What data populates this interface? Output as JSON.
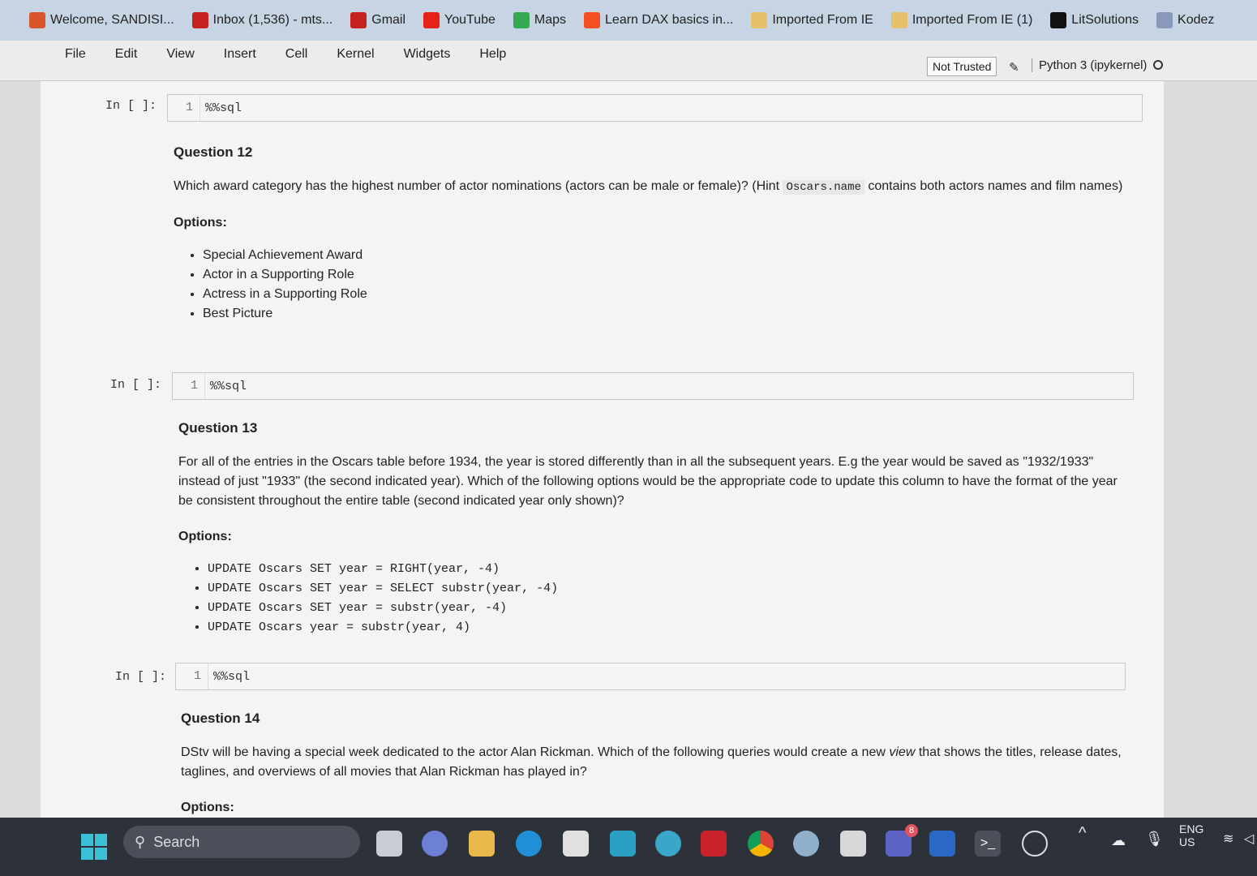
{
  "bookmarks": [
    {
      "label": "Welcome, SANDISI...",
      "icon": "pencil-icon",
      "color": "#d9552b"
    },
    {
      "label": "Inbox (1,536) - mts...",
      "icon": "gmail-icon",
      "color": "#c5221f"
    },
    {
      "label": "Gmail",
      "icon": "gmail-icon",
      "color": "#c5221f"
    },
    {
      "label": "YouTube",
      "icon": "youtube-icon",
      "color": "#e62117"
    },
    {
      "label": "Maps",
      "icon": "maps-icon",
      "color": "#34a853"
    },
    {
      "label": "Learn DAX basics in...",
      "icon": "microsoft-icon",
      "color": "#f25022"
    },
    {
      "label": "Imported From IE",
      "icon": "folder-icon",
      "color": "#e6c06a"
    },
    {
      "label": "Imported From IE (1)",
      "icon": "folder-icon",
      "color": "#e6c06a"
    },
    {
      "label": "LitSolutions",
      "icon": "lit-icon",
      "color": "#111111"
    },
    {
      "label": "Kodez",
      "icon": "kodez-icon",
      "color": "#8899bb"
    }
  ],
  "menu": [
    "File",
    "Edit",
    "View",
    "Insert",
    "Cell",
    "Kernel",
    "Widgets",
    "Help"
  ],
  "status": {
    "trusted": "Not Trusted",
    "kernel": "Python 3 (ipykernel)"
  },
  "cells": [
    {
      "prompt": "In [ ]:",
      "line": "1",
      "code": "%%sql"
    },
    {
      "prompt": "In [ ]:",
      "line": "1",
      "code": "%%sql"
    },
    {
      "prompt": "In [ ]:",
      "line": "1",
      "code": "%%sql"
    }
  ],
  "q12": {
    "title": "Question 12",
    "text_a": "Which award category has the highest number of actor nominations (actors can be male or female)? (Hint ",
    "hint_code": "Oscars.name",
    "text_b": " contains both actors names and film names)",
    "options_label": "Options:",
    "options": [
      "Special Achievement Award",
      "Actor in a Supporting Role",
      "Actress in a Supporting Role",
      "Best Picture"
    ]
  },
  "q13": {
    "title": "Question 13",
    "text": "For all of the entries in the Oscars table before 1934, the year is stored differently than in all the subsequent years. E.g the year would be saved as \"1932/1933\" instead of just \"1933\" (the second indicated year). Which of the following options would be the appropriate code to update this column to have the format of the year be consistent throughout the entire table (second indicated year only shown)?",
    "options_label": "Options:",
    "options": [
      "UPDATE Oscars SET year = RIGHT(year, -4)",
      "UPDATE Oscars SET year = SELECT substr(year, -4)",
      "UPDATE Oscars SET year = substr(year, -4)",
      "UPDATE Oscars year =  substr(year, 4)"
    ]
  },
  "q14": {
    "title": "Question 14",
    "text_a": "DStv will be having a special week dedicated to the actor Alan Rickman. Which of the following queries would create a new ",
    "text_em": "view",
    "text_b": " that shows the titles, release dates, taglines, and overviews of all movies that Alan Rickman has played in?",
    "options_label": "Options:"
  },
  "taskbar": {
    "search": "Search",
    "lang": "ENG",
    "region": "US",
    "teams_badge": "8"
  }
}
